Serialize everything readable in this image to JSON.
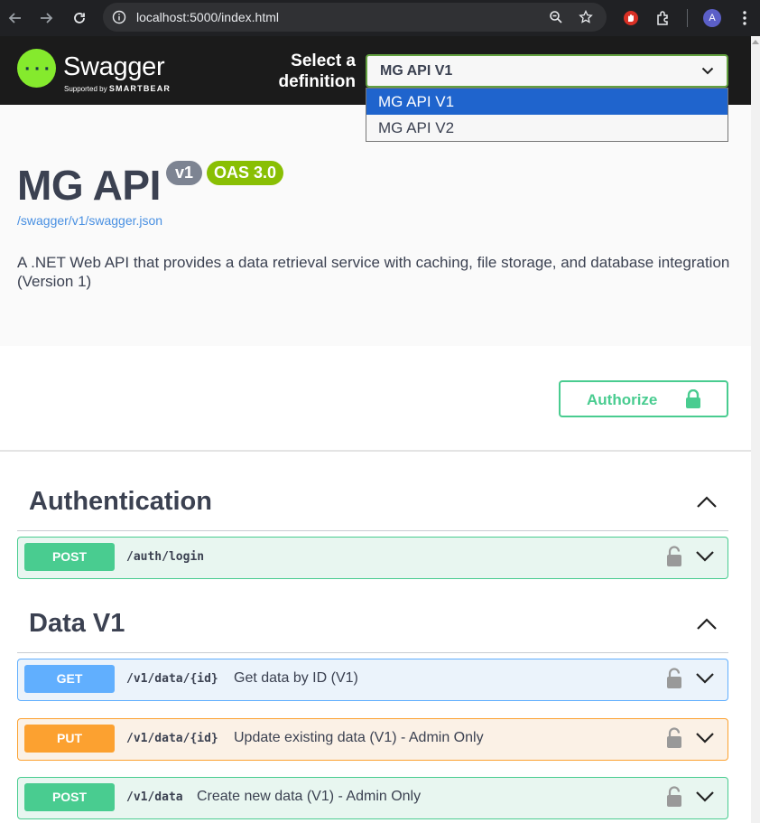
{
  "browser": {
    "url": "localhost:5000/index.html",
    "avatar_initial": "A"
  },
  "topbar": {
    "logo_name": "Swagger",
    "logo_sub_prefix": "Supported by",
    "logo_sub_brand": "SMARTBEAR",
    "select_label_line1": "Select a",
    "select_label_line2": "definition",
    "selected_definition": "MG API V1",
    "options": [
      "MG API V1",
      "MG API V2"
    ]
  },
  "info": {
    "title": "MG API",
    "version_badge": "v1",
    "oas_badge": "OAS 3.0",
    "spec_link": "/swagger/v1/swagger.json",
    "description": "A .NET Web API that provides a data retrieval service with caching, file storage, and database integration (Version 1)"
  },
  "scheme": {
    "authorize_label": "Authorize"
  },
  "tags": [
    {
      "name": "Authentication",
      "operations": [
        {
          "method": "POST",
          "path": "/auth/login",
          "summary": ""
        }
      ]
    },
    {
      "name": "Data V1",
      "operations": [
        {
          "method": "GET",
          "path": "/v1/data/{id}",
          "summary": "Get data by ID (V1)"
        },
        {
          "method": "PUT",
          "path": "/v1/data/{id}",
          "summary": "Update existing data (V1) - Admin Only"
        },
        {
          "method": "POST",
          "path": "/v1/data",
          "summary": "Create new data (V1) - Admin Only"
        }
      ]
    }
  ],
  "colors": {
    "post": "#49cc90",
    "get": "#61affe",
    "put": "#fca130",
    "logo_green": "#85ea2d",
    "badge_oas": "#89bf04",
    "badge_version": "#7d8492"
  }
}
